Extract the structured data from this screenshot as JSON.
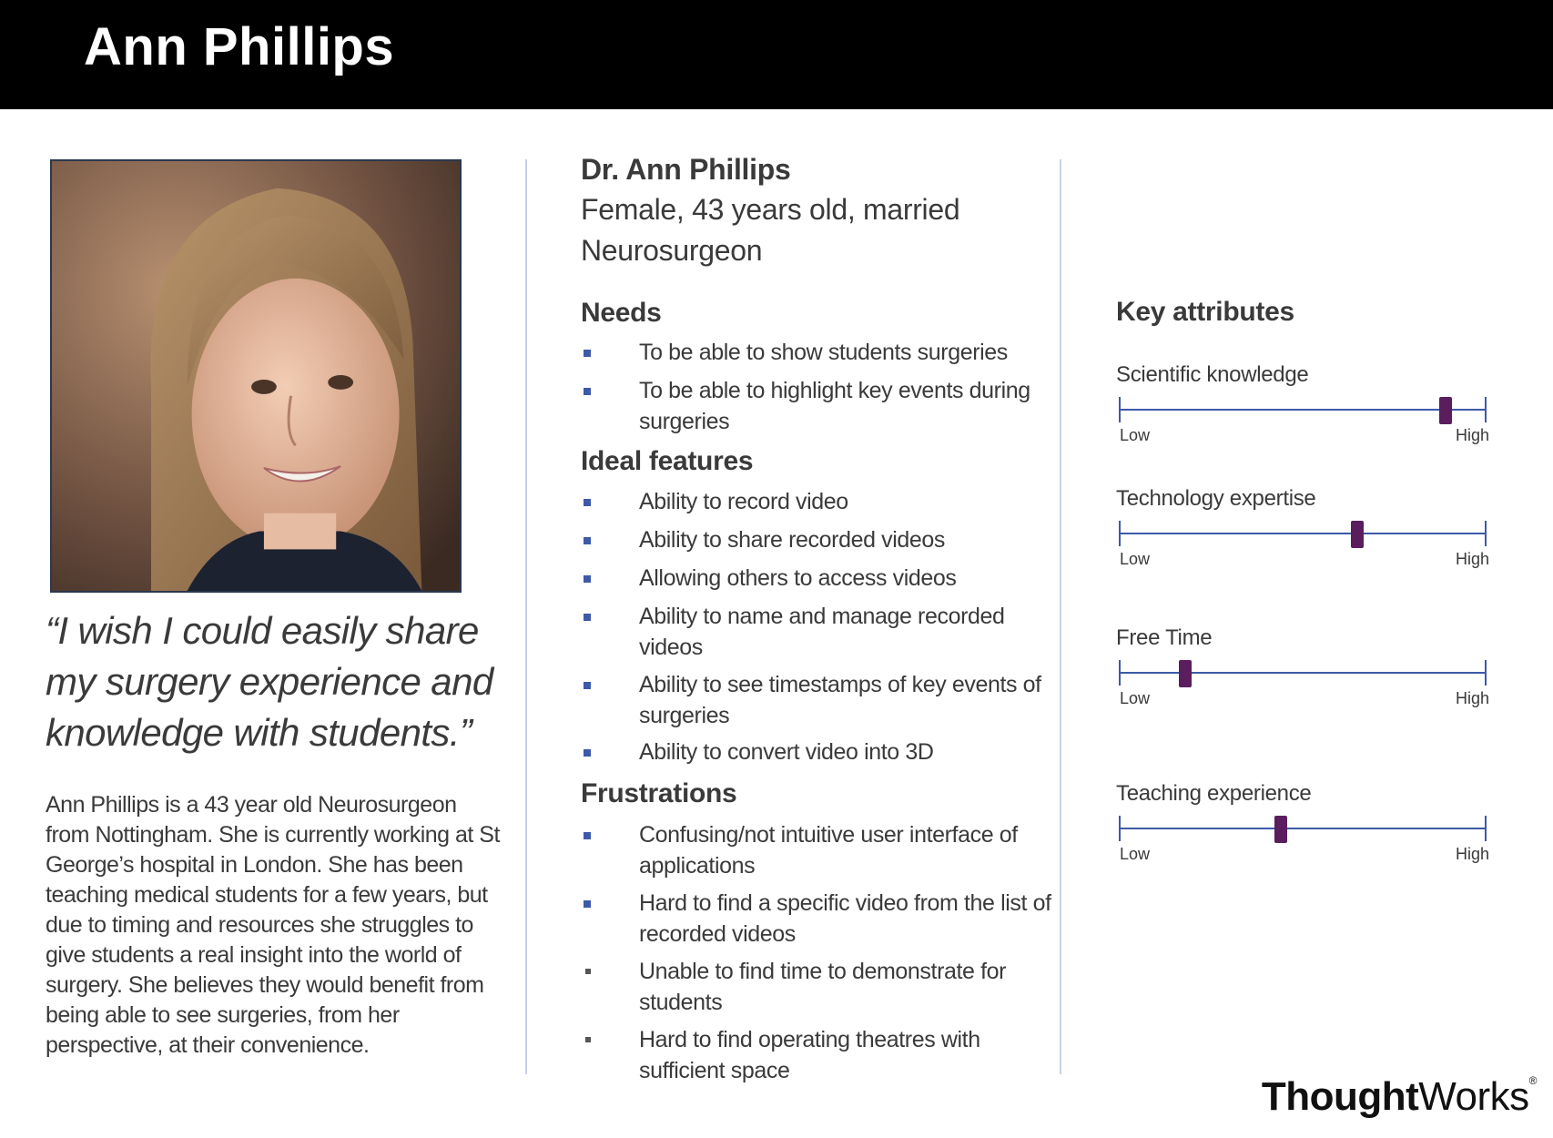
{
  "header": {
    "title": "Ann Phillips"
  },
  "quote": "“I wish I could easily share my surgery experience and knowledge with students.”",
  "bio": "Ann Phillips is a 43 year old Neurosurgeon from Nottingham. She is currently working at St George’s hospital in London. She has been teaching medical students for a few years, but due to timing and resources she struggles to give students a real insight into the world of surgery. She believes they would benefit from being able to see surgeries, from her perspective, at their convenience.",
  "profile": {
    "name": "Dr. Ann Phillips",
    "demographics": "Female, 43 years old, married",
    "occupation": "Neurosurgeon"
  },
  "needs": {
    "title": "Needs",
    "items": [
      "To be able to show students surgeries",
      "To be able to highlight key events during surgeries"
    ]
  },
  "features": {
    "title": "Ideal features",
    "items": [
      "Ability to record video",
      "Ability to share recorded videos",
      "Allowing others to access videos",
      "Ability to name and manage recorded videos",
      "Ability to see timestamps of key events of surgeries",
      "Ability to convert video into 3D"
    ]
  },
  "frustrations": {
    "title": "Frustrations",
    "items": [
      "Confusing/not intuitive user interface of applications",
      "Hard to find a specific video from the list of recorded videos",
      "Unable to find time to demonstrate for students",
      "Hard to find operating theatres with sufficient space"
    ]
  },
  "key_attributes": {
    "title": "Key attributes",
    "items": [
      {
        "label": "Scientific knowledge",
        "low": "Low",
        "high": "High",
        "level": 0.89
      },
      {
        "label": "Technology expertise",
        "low": "Low",
        "high": "High",
        "level": 0.65
      },
      {
        "label": "Free Time",
        "low": "Low",
        "high": "High",
        "level": 0.18
      },
      {
        "label": "Teaching experience",
        "low": "Low",
        "high": "High",
        "level": 0.44
      }
    ]
  },
  "colors": {
    "accent": "#3d5aa8",
    "thumb": "#5a1e5e",
    "header_bg": "#000000"
  },
  "logo": {
    "bold": "Thought",
    "regular": "Works",
    "mark": "®"
  }
}
